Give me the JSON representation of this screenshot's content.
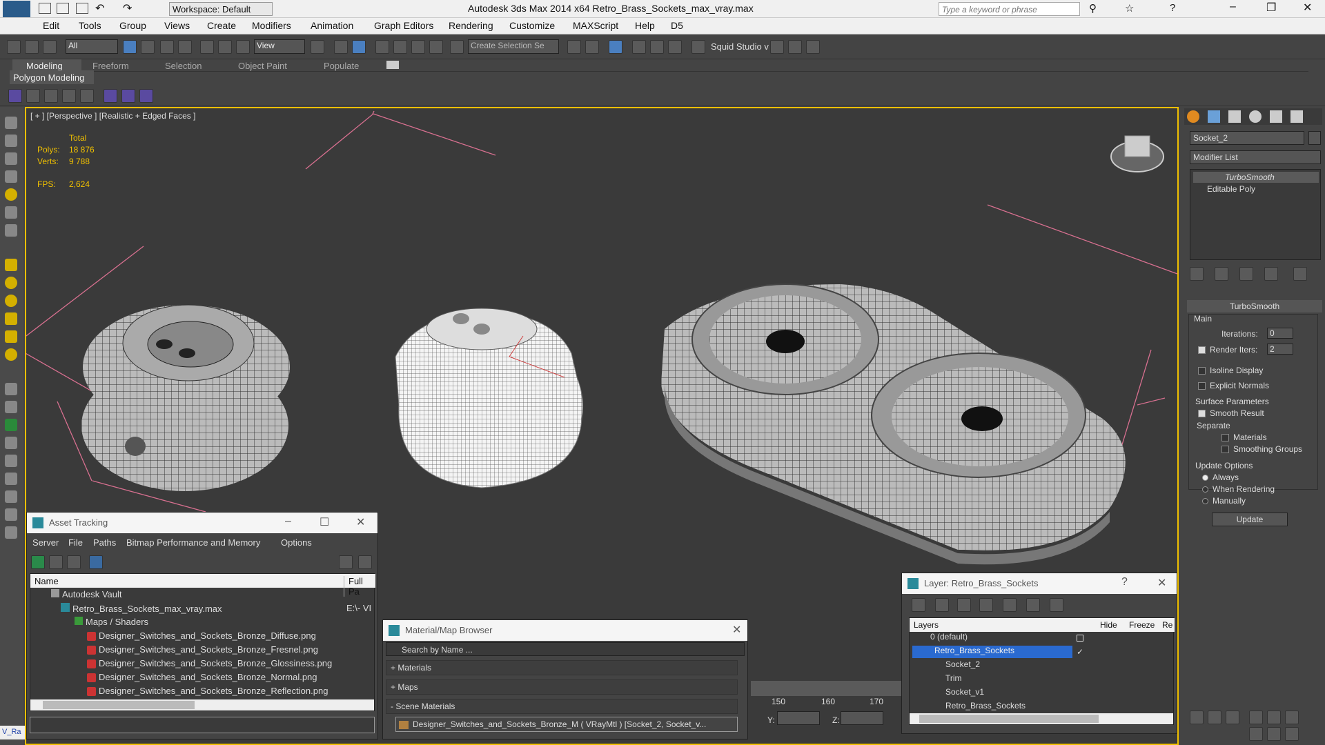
{
  "app": {
    "title": "Autodesk 3ds Max  2014 x64     Retro_Brass_Sockets_max_vray.max",
    "workspace": "Workspace: Default",
    "search_placeholder": "Type a keyword or phrase"
  },
  "menu": [
    "Edit",
    "Tools",
    "Group",
    "Views",
    "Create",
    "Modifiers",
    "Animation",
    "Graph Editors",
    "Rendering",
    "Customize",
    "MAXScript",
    "Help",
    "D5"
  ],
  "toolbar": {
    "filter": "All",
    "coord": "View",
    "selection_set": "Create Selection Se",
    "squid": "Squid Studio v"
  },
  "ribbon": {
    "tabs": [
      "Modeling",
      "Freeform",
      "Selection",
      "Object Paint",
      "Populate"
    ],
    "sub": "Polygon Modeling"
  },
  "viewport": {
    "label": "[ + ] [Perspective ] [Realistic + Edged Faces ]",
    "stats": {
      "total": "Total",
      "polys_label": "Polys:",
      "polys": "18 876",
      "verts_label": "Verts:",
      "verts": "9 788",
      "fps_label": "FPS:",
      "fps": "2,624"
    }
  },
  "modifier": {
    "object_name": "Socket_2",
    "list_label": "Modifier List",
    "stack": [
      "TurboSmooth",
      "Editable Poly"
    ],
    "rollout": "TurboSmooth",
    "main": "Main",
    "iterations_label": "Iterations:",
    "iterations": "0",
    "render_iters_label": "Render Iters:",
    "render_iters": "2",
    "isoline": "Isoline Display",
    "explicit": "Explicit Normals",
    "surface": "Surface Parameters",
    "smooth_result": "Smooth Result",
    "separate": "Separate",
    "materials": "Materials",
    "smoothing_groups": "Smoothing Groups",
    "update_options": "Update Options",
    "always": "Always",
    "when_rendering": "When Rendering",
    "manually": "Manually",
    "update_btn": "Update"
  },
  "asset": {
    "title": "Asset Tracking",
    "menu": [
      "Server",
      "File",
      "Paths",
      "Bitmap Performance and Memory",
      "Options"
    ],
    "col_name": "Name",
    "col_path": "Full Pa",
    "rows": [
      {
        "name": "Autodesk Vault",
        "path": ""
      },
      {
        "name": "Retro_Brass_Sockets_max_vray.max",
        "path": "E:\\- VI"
      },
      {
        "name": "Maps / Shaders",
        "path": ""
      },
      {
        "name": "Designer_Switches_and_Sockets_Bronze_Diffuse.png",
        "path": ""
      },
      {
        "name": "Designer_Switches_and_Sockets_Bronze_Fresnel.png",
        "path": ""
      },
      {
        "name": "Designer_Switches_and_Sockets_Bronze_Glossiness.png",
        "path": ""
      },
      {
        "name": "Designer_Switches_and_Sockets_Bronze_Normal.png",
        "path": ""
      },
      {
        "name": "Designer_Switches_and_Sockets_Bronze_Reflection.png",
        "path": ""
      }
    ]
  },
  "material": {
    "title": "Material/Map Browser",
    "search": "Search by Name ...",
    "groups": [
      "+ Materials",
      "+ Maps",
      "- Scene Materials"
    ],
    "item": "Designer_Switches_and_Sockets_Bronze_M  ( VRayMtl ) [Socket_2, Socket_v..."
  },
  "layer": {
    "title": "Layer: Retro_Brass_Sockets",
    "cols": [
      "Layers",
      "Hide",
      "Freeze",
      "Re"
    ],
    "rows": [
      "0 (default)",
      "Retro_Brass_Sockets",
      "Socket_2",
      "Trim",
      "Socket_v1",
      "Retro_Brass_Sockets"
    ]
  },
  "timeline": {
    "ticks": [
      "150",
      "160",
      "170"
    ],
    "y_label": "Y:",
    "z_label": "Z:"
  },
  "status": {
    "script": "V_Ra"
  }
}
